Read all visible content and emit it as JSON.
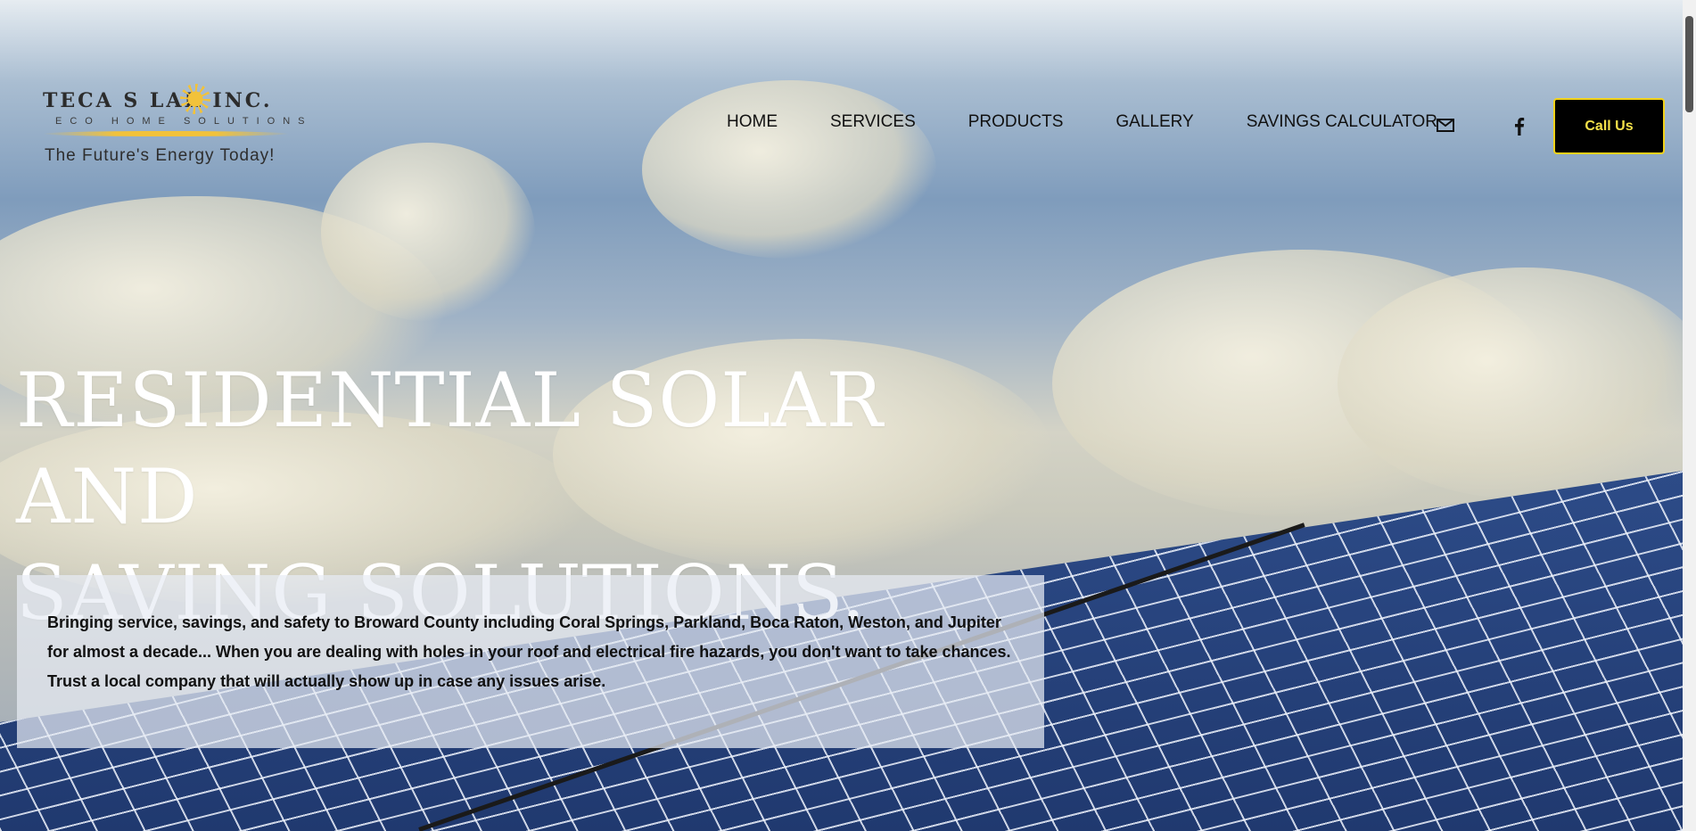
{
  "brand": {
    "name": "TECA S LAR INC.",
    "sub": "ECO HOME SOLUTIONS",
    "tagline": "The Future's Energy Today!",
    "accent": "#f2c23a"
  },
  "nav": {
    "items": [
      "HOME",
      "SERVICES",
      "PRODUCTS",
      "GALLERY",
      "SAVINGS CALCULATOR"
    ],
    "email_icon": "mail-icon",
    "facebook_icon": "facebook-icon",
    "call_label": "Call Us",
    "call_button_colors": {
      "background": "#000000",
      "border": "#f2d21a",
      "text": "#f5e14a"
    }
  },
  "hero": {
    "headline_line1": "RESIDENTIAL SOLAR AND",
    "headline_line2": "SAVING SOLUTIONS.",
    "intro": "Bringing service, savings, and safety to Broward County including Coral Springs, Parkland, Boca Raton, Weston, and Jupiter for almost a decade... When you are dealing with holes in your roof and electrical fire hazards, you don't want to take chances. Trust a local company that will actually show up in case any issues arise."
  }
}
